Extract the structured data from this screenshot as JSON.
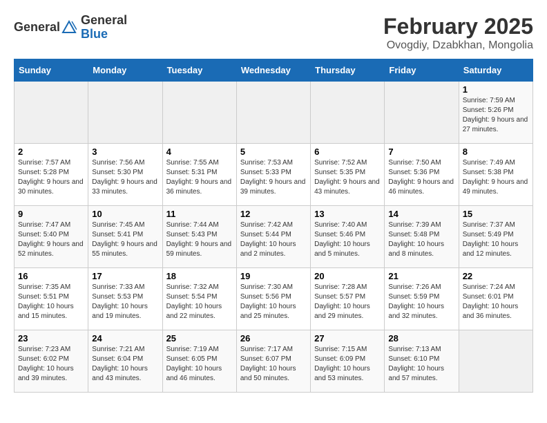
{
  "logo": {
    "general": "General",
    "blue": "Blue"
  },
  "title": "February 2025",
  "subtitle": "Ovogdiy, Dzabkhan, Mongolia",
  "weekdays": [
    "Sunday",
    "Monday",
    "Tuesday",
    "Wednesday",
    "Thursday",
    "Friday",
    "Saturday"
  ],
  "weeks": [
    [
      {
        "day": "",
        "info": ""
      },
      {
        "day": "",
        "info": ""
      },
      {
        "day": "",
        "info": ""
      },
      {
        "day": "",
        "info": ""
      },
      {
        "day": "",
        "info": ""
      },
      {
        "day": "",
        "info": ""
      },
      {
        "day": "1",
        "info": "Sunrise: 7:59 AM\nSunset: 5:26 PM\nDaylight: 9 hours and 27 minutes."
      }
    ],
    [
      {
        "day": "2",
        "info": "Sunrise: 7:57 AM\nSunset: 5:28 PM\nDaylight: 9 hours and 30 minutes."
      },
      {
        "day": "3",
        "info": "Sunrise: 7:56 AM\nSunset: 5:30 PM\nDaylight: 9 hours and 33 minutes."
      },
      {
        "day": "4",
        "info": "Sunrise: 7:55 AM\nSunset: 5:31 PM\nDaylight: 9 hours and 36 minutes."
      },
      {
        "day": "5",
        "info": "Sunrise: 7:53 AM\nSunset: 5:33 PM\nDaylight: 9 hours and 39 minutes."
      },
      {
        "day": "6",
        "info": "Sunrise: 7:52 AM\nSunset: 5:35 PM\nDaylight: 9 hours and 43 minutes."
      },
      {
        "day": "7",
        "info": "Sunrise: 7:50 AM\nSunset: 5:36 PM\nDaylight: 9 hours and 46 minutes."
      },
      {
        "day": "8",
        "info": "Sunrise: 7:49 AM\nSunset: 5:38 PM\nDaylight: 9 hours and 49 minutes."
      }
    ],
    [
      {
        "day": "9",
        "info": "Sunrise: 7:47 AM\nSunset: 5:40 PM\nDaylight: 9 hours and 52 minutes."
      },
      {
        "day": "10",
        "info": "Sunrise: 7:45 AM\nSunset: 5:41 PM\nDaylight: 9 hours and 55 minutes."
      },
      {
        "day": "11",
        "info": "Sunrise: 7:44 AM\nSunset: 5:43 PM\nDaylight: 9 hours and 59 minutes."
      },
      {
        "day": "12",
        "info": "Sunrise: 7:42 AM\nSunset: 5:44 PM\nDaylight: 10 hours and 2 minutes."
      },
      {
        "day": "13",
        "info": "Sunrise: 7:40 AM\nSunset: 5:46 PM\nDaylight: 10 hours and 5 minutes."
      },
      {
        "day": "14",
        "info": "Sunrise: 7:39 AM\nSunset: 5:48 PM\nDaylight: 10 hours and 8 minutes."
      },
      {
        "day": "15",
        "info": "Sunrise: 7:37 AM\nSunset: 5:49 PM\nDaylight: 10 hours and 12 minutes."
      }
    ],
    [
      {
        "day": "16",
        "info": "Sunrise: 7:35 AM\nSunset: 5:51 PM\nDaylight: 10 hours and 15 minutes."
      },
      {
        "day": "17",
        "info": "Sunrise: 7:33 AM\nSunset: 5:53 PM\nDaylight: 10 hours and 19 minutes."
      },
      {
        "day": "18",
        "info": "Sunrise: 7:32 AM\nSunset: 5:54 PM\nDaylight: 10 hours and 22 minutes."
      },
      {
        "day": "19",
        "info": "Sunrise: 7:30 AM\nSunset: 5:56 PM\nDaylight: 10 hours and 25 minutes."
      },
      {
        "day": "20",
        "info": "Sunrise: 7:28 AM\nSunset: 5:57 PM\nDaylight: 10 hours and 29 minutes."
      },
      {
        "day": "21",
        "info": "Sunrise: 7:26 AM\nSunset: 5:59 PM\nDaylight: 10 hours and 32 minutes."
      },
      {
        "day": "22",
        "info": "Sunrise: 7:24 AM\nSunset: 6:01 PM\nDaylight: 10 hours and 36 minutes."
      }
    ],
    [
      {
        "day": "23",
        "info": "Sunrise: 7:23 AM\nSunset: 6:02 PM\nDaylight: 10 hours and 39 minutes."
      },
      {
        "day": "24",
        "info": "Sunrise: 7:21 AM\nSunset: 6:04 PM\nDaylight: 10 hours and 43 minutes."
      },
      {
        "day": "25",
        "info": "Sunrise: 7:19 AM\nSunset: 6:05 PM\nDaylight: 10 hours and 46 minutes."
      },
      {
        "day": "26",
        "info": "Sunrise: 7:17 AM\nSunset: 6:07 PM\nDaylight: 10 hours and 50 minutes."
      },
      {
        "day": "27",
        "info": "Sunrise: 7:15 AM\nSunset: 6:09 PM\nDaylight: 10 hours and 53 minutes."
      },
      {
        "day": "28",
        "info": "Sunrise: 7:13 AM\nSunset: 6:10 PM\nDaylight: 10 hours and 57 minutes."
      },
      {
        "day": "",
        "info": ""
      }
    ]
  ]
}
